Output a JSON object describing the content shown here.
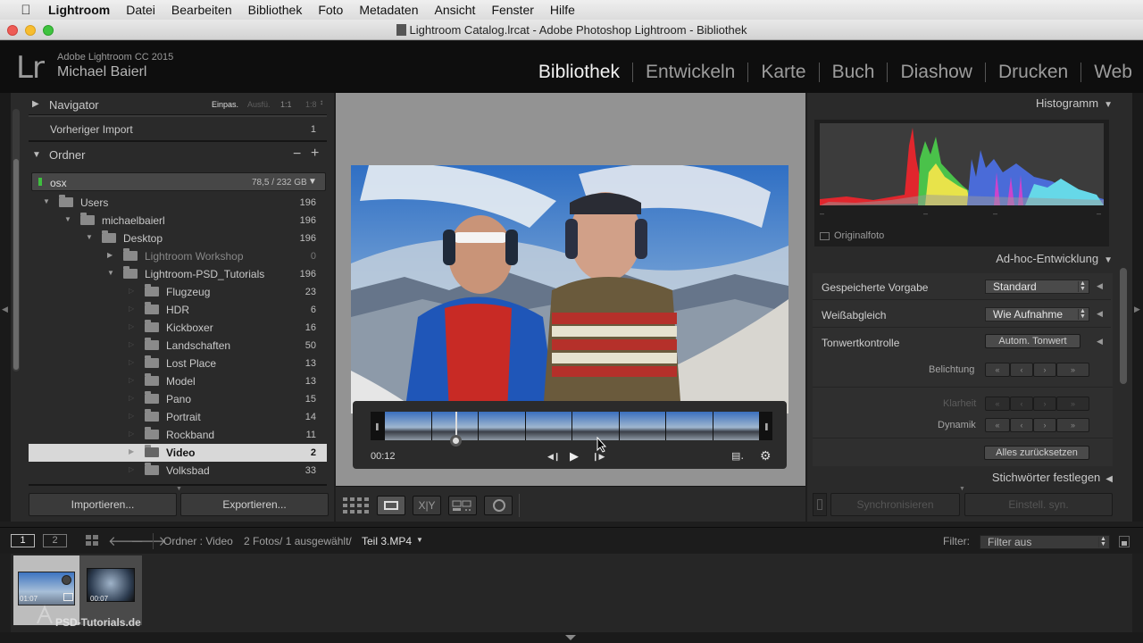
{
  "menubar": {
    "app": "Lightroom",
    "items": [
      "Datei",
      "Bearbeiten",
      "Bibliothek",
      "Foto",
      "Metadaten",
      "Ansicht",
      "Fenster",
      "Hilfe"
    ]
  },
  "window": {
    "title": "Lightroom Catalog.lrcat - Adobe Photoshop Lightroom - Bibliothek"
  },
  "identity": {
    "logo": "Lr",
    "product": "Adobe Lightroom CC 2015",
    "user": "Michael Baierl"
  },
  "modules": [
    "Bibliothek",
    "Entwickeln",
    "Karte",
    "Buch",
    "Diashow",
    "Drucken",
    "Web"
  ],
  "left_panel": {
    "navigator": {
      "title": "Navigator",
      "zoom_options": [
        "Einpas.",
        "Ausfü.",
        "1:1",
        "1:8"
      ]
    },
    "previous_import": {
      "label": "Vorheriger Import",
      "count": "1"
    },
    "folders_title": "Ordner",
    "volume": {
      "name": "osx",
      "space": "78,5 / 232 GB"
    },
    "folders": [
      {
        "name": "Users",
        "count": "196"
      },
      {
        "name": "michaelbaierl",
        "count": "196"
      },
      {
        "name": "Desktop",
        "count": "196"
      },
      {
        "name": "Lightroom Workshop",
        "count": "0"
      },
      {
        "name": "Lightroom-PSD_Tutorials",
        "count": "196"
      },
      {
        "name": "Flugzeug",
        "count": "23"
      },
      {
        "name": "HDR",
        "count": "6"
      },
      {
        "name": "Kickboxer",
        "count": "16"
      },
      {
        "name": "Landschaften",
        "count": "50"
      },
      {
        "name": "Lost Place",
        "count": "13"
      },
      {
        "name": "Model",
        "count": "13"
      },
      {
        "name": "Pano",
        "count": "15"
      },
      {
        "name": "Portrait",
        "count": "14"
      },
      {
        "name": "Rockband",
        "count": "11"
      },
      {
        "name": "Video",
        "count": "2"
      },
      {
        "name": "Volksbad",
        "count": "33"
      }
    ],
    "import_button": "Importieren...",
    "export_button": "Exportieren..."
  },
  "video": {
    "time": "00:12"
  },
  "right_panel": {
    "histogram_title": "Histogramm",
    "original_photo": "Originalfoto",
    "quick_develop_title": "Ad-hoc-Entwicklung",
    "saved_preset_label": "Gespeicherte Vorgabe",
    "saved_preset_value": "Standard",
    "white_balance_label": "Weißabgleich",
    "white_balance_value": "Wie Aufnahme",
    "tone_control_label": "Tonwertkontrolle",
    "auto_tone_button": "Autom. Tonwert",
    "exposure_label": "Belichtung",
    "clarity_label": "Klarheit",
    "vibrance_label": "Dynamik",
    "reset_all_button": "Alles zurücksetzen",
    "keywording_title": "Stichwörter festlegen",
    "sync_button": "Synchronisieren",
    "sync_settings_button": "Einstell. syn."
  },
  "filmstrip_bar": {
    "screen1": "1",
    "screen2": "2",
    "source": "Ordner : Video",
    "info": "2 Fotos/ 1 ausgewählt/",
    "file": "Teil 3.MP4",
    "filter_label": "Filter:",
    "filter_value": "Filter aus"
  },
  "filmstrip": [
    {
      "duration": "01:07",
      "selected": true
    },
    {
      "duration": "00:07",
      "selected": false
    }
  ],
  "watermark": "PSD-Tutorials.de",
  "colors": {
    "active_module": "#f2f2f2",
    "panel": "#2a2a2a",
    "selected_folder": "#d8d8d8"
  }
}
